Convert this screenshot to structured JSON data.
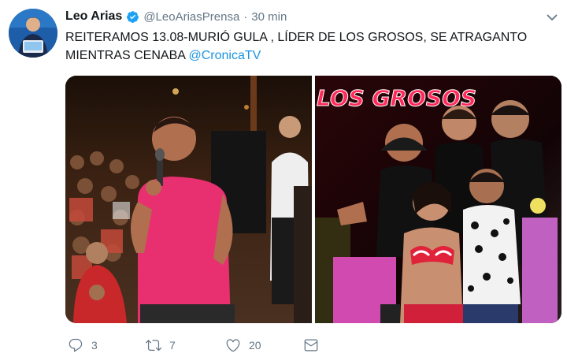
{
  "author": {
    "name": "Leo Arias",
    "handle": "@LeoAriasPrensa",
    "separator": "·",
    "time": "30 min",
    "verified": true
  },
  "tweet": {
    "text_line1": "REITERAMOS 13.08-MURIÓ GULA , LÍDER DE LOS GROSOS, SE ATRAGANTO",
    "text_line2": "MIENTRAS CENABA ",
    "mention": "@CronicaTV"
  },
  "media": {
    "right_photo_caption": "LOS GROSOS"
  },
  "actions": {
    "replies": "3",
    "retweets": "7",
    "likes": "20"
  },
  "icons": {
    "verified": "verified-badge-icon",
    "menu": "chevron-down-icon",
    "reply": "reply-icon",
    "retweet": "retweet-icon",
    "like": "heart-icon",
    "dm": "envelope-icon"
  },
  "colors": {
    "link": "#1b95e0",
    "verified": "#1da1f2",
    "muted": "#657786",
    "text": "#14171a"
  }
}
